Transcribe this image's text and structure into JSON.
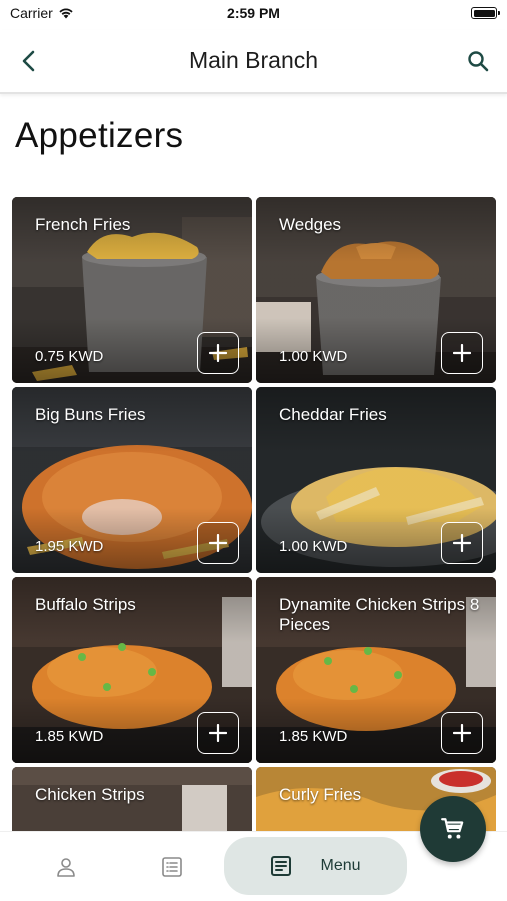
{
  "status_bar": {
    "carrier": "Carrier",
    "time": "2:59 PM"
  },
  "header": {
    "title": "Main Branch"
  },
  "section": {
    "heading": "Appetizers"
  },
  "items": [
    {
      "name": "French Fries",
      "price": "0.75 KWD"
    },
    {
      "name": "Wedges",
      "price": "1.00 KWD"
    },
    {
      "name": "Big Buns Fries",
      "price": "1.95 KWD"
    },
    {
      "name": "Cheddar Fries",
      "price": "1.00 KWD"
    },
    {
      "name": "Buffalo Strips",
      "price": "1.85 KWD"
    },
    {
      "name": "Dynamite Chicken Strips 8 Pieces",
      "price": "1.85 KWD"
    },
    {
      "name": "Chicken Strips",
      "price": ""
    },
    {
      "name": "Curly Fries",
      "price": ""
    }
  ],
  "tabbar": {
    "menu_label": "Menu"
  },
  "colors": {
    "accent": "#1f3a36",
    "active_tab_bg": "#dfe6e4",
    "icon": "#1e4a44"
  }
}
